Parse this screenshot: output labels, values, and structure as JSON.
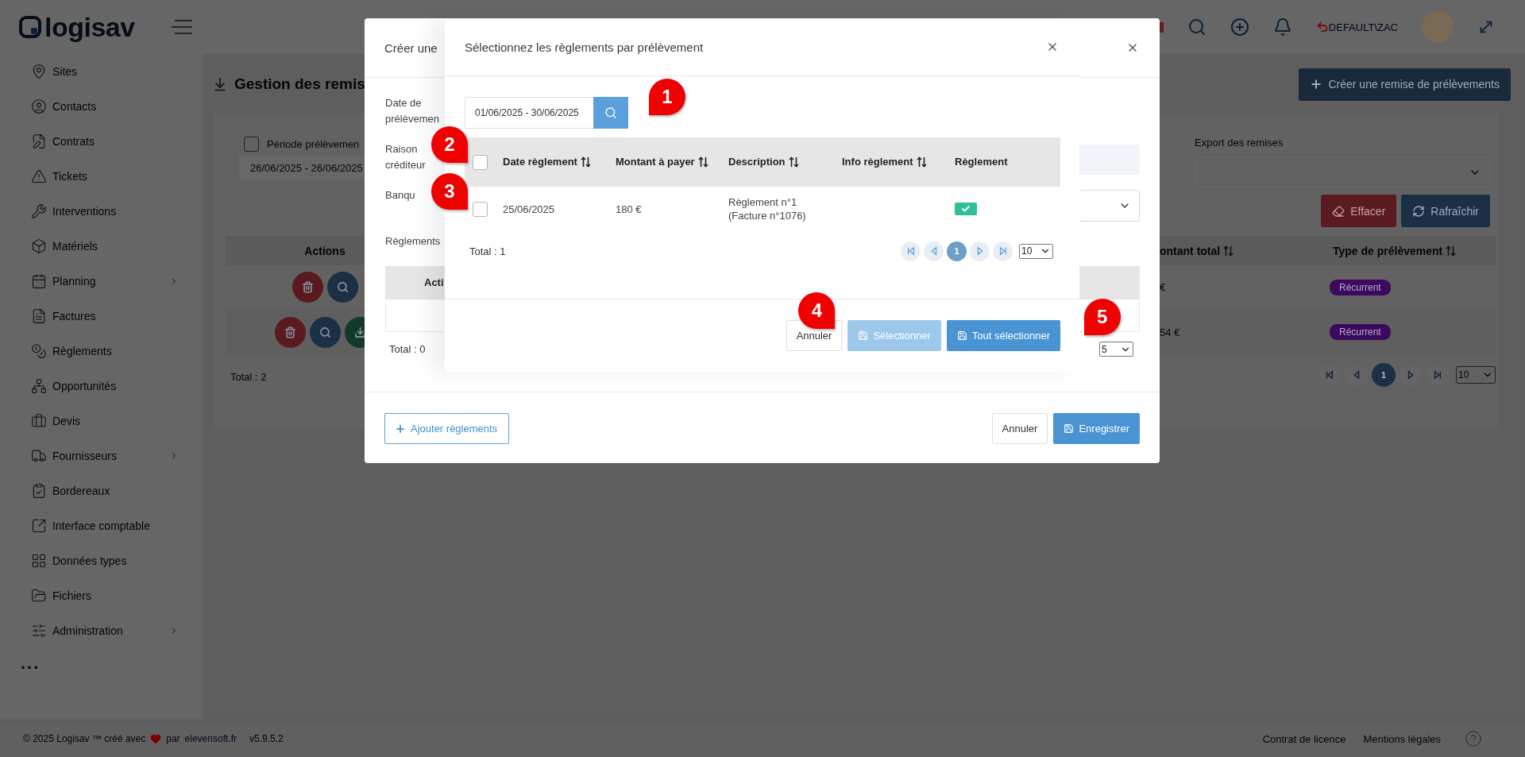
{
  "header": {
    "logo": "logisav",
    "user": "DEFAULT\\ZAC"
  },
  "sidebar": {
    "items": [
      {
        "label": "Sites",
        "has_submenu": false
      },
      {
        "label": "Contacts",
        "has_submenu": false
      },
      {
        "label": "Contrats",
        "has_submenu": false
      },
      {
        "label": "Tickets",
        "has_submenu": false
      },
      {
        "label": "Interventions",
        "has_submenu": false
      },
      {
        "label": "Matériels",
        "has_submenu": false
      },
      {
        "label": "Planning",
        "has_submenu": true
      },
      {
        "label": "Factures",
        "has_submenu": false
      },
      {
        "label": "Règlements",
        "has_submenu": false
      },
      {
        "label": "Opportunités",
        "has_submenu": false
      },
      {
        "label": "Devis",
        "has_submenu": false
      },
      {
        "label": "Fournisseurs",
        "has_submenu": true
      },
      {
        "label": "Bordereaux",
        "has_submenu": false
      },
      {
        "label": "Interface comptable",
        "has_submenu": false
      },
      {
        "label": "Données types",
        "has_submenu": false
      },
      {
        "label": "Fichiers",
        "has_submenu": false
      },
      {
        "label": "Administration",
        "has_submenu": true
      }
    ],
    "more": "..."
  },
  "page": {
    "title": "Gestion des remis",
    "create_button": "Créer une remise de prélèvements",
    "filters": {
      "period": {
        "label": "Période prélèvemen",
        "checked": false
      },
      "period_value": "26/06/2025 - 26/06/2025",
      "export_label": "Export des remises",
      "clear_button": "Effacer",
      "refresh_button": "Rafraîchir"
    },
    "table": {
      "columns": [
        {
          "label": "Actions",
          "sortable": false
        },
        {
          "label": "ontant total",
          "sortable": true
        },
        {
          "label": "Type de prélèvement",
          "sortable": true
        }
      ],
      "rows": [
        {
          "actions": [
            {
              "kind": "delete"
            },
            {
              "kind": "view"
            }
          ],
          "amount": "€",
          "type": "Récurrent"
        },
        {
          "actions": [
            {
              "kind": "delete"
            },
            {
              "kind": "view"
            },
            {
              "kind": "download"
            }
          ],
          "amount": "54 €",
          "type": "Récurrent"
        }
      ],
      "total": "Total : 2",
      "pagination": {
        "pages": [
          {
            "label": "1",
            "selected": true
          }
        ],
        "page_size": "10"
      }
    }
  },
  "create_modal": {
    "title": "Créer une",
    "fields": [
      {
        "label": "Date de prélèvemen",
        "kind": "none"
      },
      {
        "label": "Raison créditeur",
        "kind": "input"
      },
      {
        "label": "Banqu",
        "kind": "select"
      }
    ],
    "payments_label": "Règlements",
    "table": {
      "columns": [
        "Acti"
      ],
      "total": "Total : 0",
      "page_size": "5"
    },
    "footer": {
      "add_button": "Ajouter règlements",
      "cancel_button": "Annuler",
      "save_button": "Enregistrer"
    }
  },
  "select_modal": {
    "title": "Sélectionnez les règlements par prélèvement",
    "date_range": "01/06/2025 - 30/06/2025",
    "search_callout": {
      "number": "1",
      "kind": "left"
    },
    "table": {
      "select_all": {
        "checked": false,
        "callout": {
          "number": "2",
          "kind": "right"
        }
      },
      "columns": [
        {
          "label": "Date règlement",
          "sortable": true
        },
        {
          "label": "Montant à payer",
          "sortable": true
        },
        {
          "label": "Description",
          "sortable": true
        },
        {
          "label": "Info règlement",
          "sortable": true
        },
        {
          "label": "Règlement",
          "sortable": false
        }
      ],
      "rows": [
        {
          "checked": false,
          "callout": {
            "number": "3",
            "kind": "right"
          },
          "date": "25/06/2025",
          "amount": "180 €",
          "description": "Règlement n°1 (Facture n°1076)",
          "paid": true
        }
      ],
      "total": "Total : 1",
      "pagination": {
        "pages": [
          {
            "label": "1",
            "selected": true
          }
        ],
        "page_size": "10"
      }
    },
    "footer": {
      "cancel_button": "Annuler",
      "select_button": {
        "label": "Sélectionner",
        "disabled": true,
        "callout": {
          "number": "4",
          "kind": "right"
        }
      },
      "select_all_button": {
        "label": "Tout sélectionner",
        "disabled": false,
        "callout": {
          "number": "5",
          "kind": "left"
        }
      }
    }
  },
  "footer": {
    "copyright": "© 2025 Logisav ™ créé avec",
    "by": "par",
    "link": "elevensoft.fr",
    "version": "v5.9.5.2",
    "license_link": "Contrat de licence",
    "legal_link": "Mentions légales"
  }
}
